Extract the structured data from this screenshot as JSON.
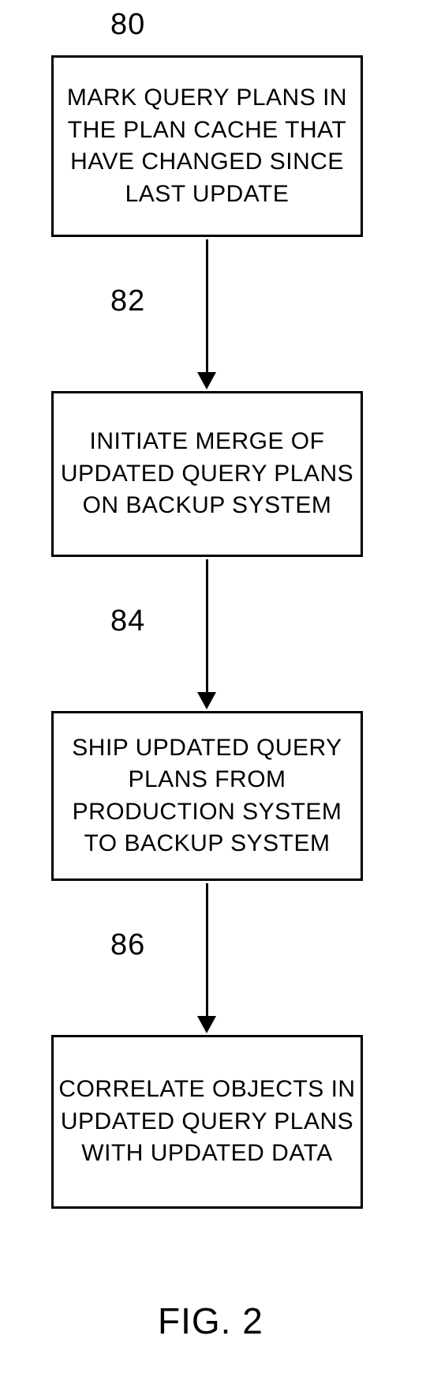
{
  "figure_label": "FIG. 2",
  "steps": [
    {
      "num": "80",
      "text": "MARK QUERY PLANS IN THE PLAN CACHE THAT HAVE CHANGED SINCE LAST UPDATE"
    },
    {
      "num": "82",
      "text": "INITIATE MERGE OF UPDATED QUERY PLANS ON BACKUP SYSTEM"
    },
    {
      "num": "84",
      "text": "SHIP UPDATED QUERY PLANS FROM PRODUCTION SYSTEM TO BACKUP SYSTEM"
    },
    {
      "num": "86",
      "text": "CORRELATE OBJECTS IN UPDATED QUERY PLANS WITH UPDATED DATA"
    }
  ]
}
